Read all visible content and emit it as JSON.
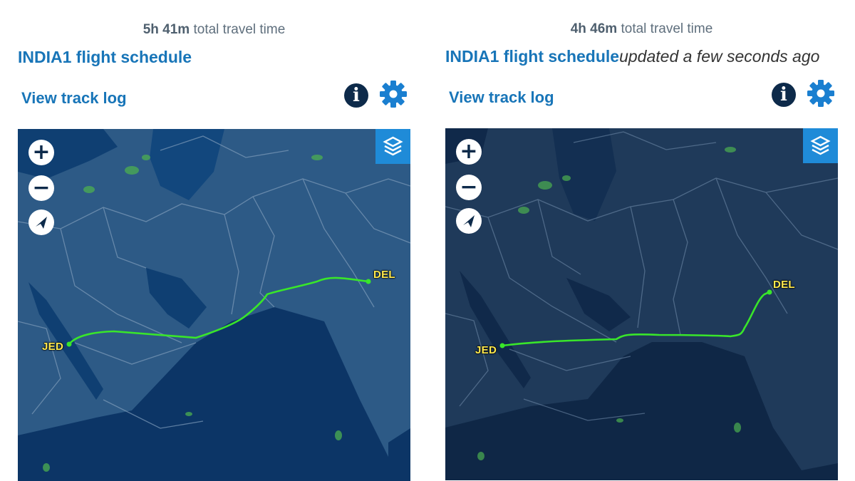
{
  "panels": [
    {
      "travel_time": "5h 41m",
      "travel_suffix": "total travel time",
      "schedule_title": "INDIA1 flight schedule",
      "updated_text": "",
      "track_log": "View track log",
      "info_glyph": "i",
      "origin_code": "JED",
      "dest_code": "DEL",
      "zoom_in": "+",
      "zoom_out": "−",
      "theme": "light"
    },
    {
      "travel_time": "4h 46m",
      "travel_suffix": "total travel time",
      "schedule_title": "INDIA1 flight schedule",
      "updated_text": "updated a few seconds ago",
      "track_log": "View track log",
      "info_glyph": "i",
      "origin_code": "JED",
      "dest_code": "DEL",
      "zoom_in": "+",
      "zoom_out": "−",
      "theme": "dark"
    }
  ],
  "colors": {
    "link": "#1875b8",
    "route": "#39e62a",
    "airport_label": "#ffe94d",
    "layers_button": "#1f8bd8",
    "map_light_land": "#2d5a86",
    "map_light_sea": "#0f3f72",
    "map_dark_land": "#1f3a5a",
    "map_dark_sea": "#10294a"
  },
  "icons": [
    "info-icon",
    "gear-icon",
    "layers-icon",
    "zoom-in-icon",
    "zoom-out-icon",
    "compass-icon"
  ]
}
